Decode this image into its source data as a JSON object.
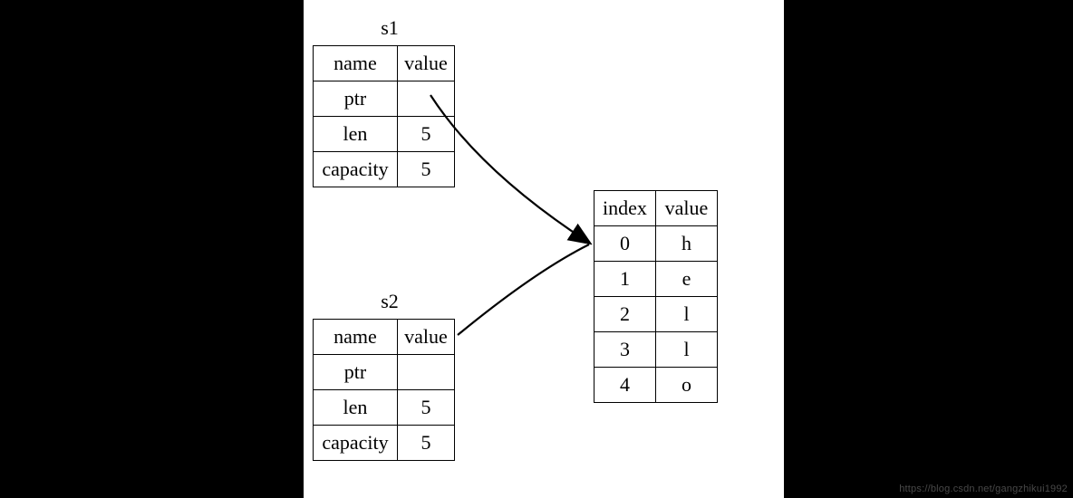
{
  "s1": {
    "title": "s1",
    "headers": {
      "name": "name",
      "value": "value"
    },
    "rows": [
      {
        "name": "ptr",
        "value": ""
      },
      {
        "name": "len",
        "value": "5"
      },
      {
        "name": "capacity",
        "value": "5"
      }
    ]
  },
  "s2": {
    "title": "s2",
    "headers": {
      "name": "name",
      "value": "value"
    },
    "rows": [
      {
        "name": "ptr",
        "value": ""
      },
      {
        "name": "len",
        "value": "5"
      },
      {
        "name": "capacity",
        "value": "5"
      }
    ]
  },
  "heap": {
    "headers": {
      "index": "index",
      "value": "value"
    },
    "rows": [
      {
        "index": "0",
        "value": "h"
      },
      {
        "index": "1",
        "value": "e"
      },
      {
        "index": "2",
        "value": "l"
      },
      {
        "index": "3",
        "value": "l"
      },
      {
        "index": "4",
        "value": "o"
      }
    ]
  },
  "watermark": "https://blog.csdn.net/gangzhikui1992"
}
